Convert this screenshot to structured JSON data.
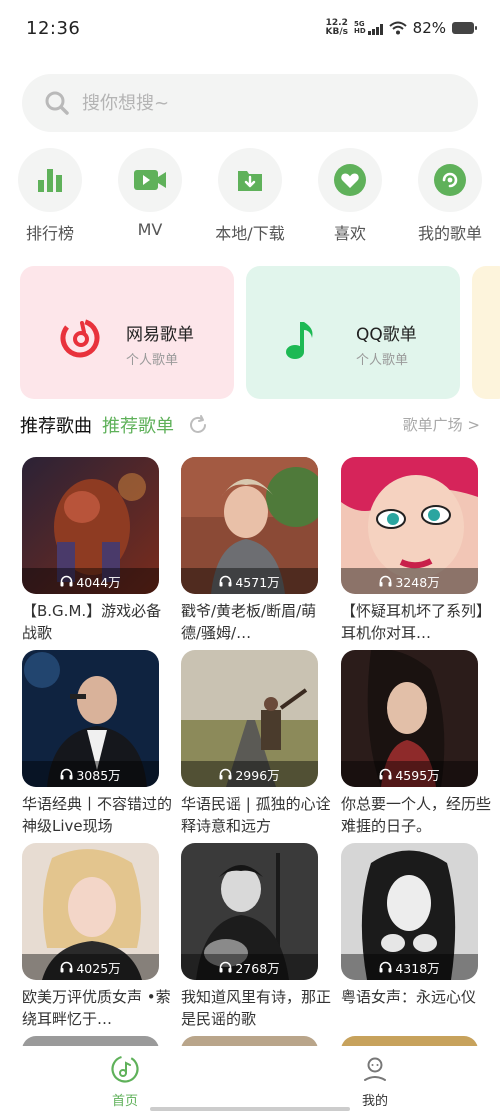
{
  "status_bar": {
    "time": "12:36",
    "net_speed_value": "12.2",
    "net_speed_unit": "KB/s",
    "signal_label_top": "5G",
    "signal_label_bottom": "HD",
    "battery": "82%"
  },
  "search": {
    "placeholder": "搜你想搜~"
  },
  "quick_nav": [
    {
      "label": "排行榜",
      "icon": "bar-chart-icon"
    },
    {
      "label": "MV",
      "icon": "video-icon"
    },
    {
      "label": "本地/下载",
      "icon": "download-folder-icon"
    },
    {
      "label": "喜欢",
      "icon": "heart-icon"
    },
    {
      "label": "我的歌单",
      "icon": "disc-icon"
    }
  ],
  "playlist_cards": [
    {
      "title": "网易歌单",
      "subtitle": "个人歌单",
      "icon": "netease-logo-icon",
      "bg": "#fde6ea"
    },
    {
      "title": "QQ歌单",
      "subtitle": "个人歌单",
      "icon": "qq-music-logo-icon",
      "bg": "#e1f5ec"
    }
  ],
  "section": {
    "tab_songs": "推荐歌曲",
    "tab_playlists": "推荐歌单",
    "more_link": "歌单广场 >"
  },
  "recommended": [
    {
      "title": "【B.G.M.】游戏必备战歌",
      "plays": "4044万"
    },
    {
      "title": "戳爷/黄老板/断眉/萌德/骚姆/…",
      "plays": "4571万"
    },
    {
      "title": "【怀疑耳机坏了系列】耳机你对耳…",
      "plays": "3248万"
    },
    {
      "title": "华语经典丨不容错过的神级Live现场",
      "plays": "3085万"
    },
    {
      "title": "华语民谣 | 孤独的心诠释诗意和远方",
      "plays": "2996万"
    },
    {
      "title": "你总要一个人，经历些难捱的日子。",
      "plays": "4595万"
    },
    {
      "title": "欧美万评优质女声 •萦绕耳畔忆于…",
      "plays": "4025万"
    },
    {
      "title": "我知道风里有诗，那正是民谣的歌",
      "plays": "2768万"
    },
    {
      "title": "粤语女声：永远心仪",
      "plays": "4318万"
    }
  ],
  "bottom_nav": [
    {
      "label": "首页",
      "icon": "home-music-icon",
      "active": true
    },
    {
      "label": "我的",
      "icon": "user-icon",
      "active": false
    }
  ],
  "colors": {
    "accent": "#5fb15a",
    "netease_red": "#e8323c",
    "qq_green": "#1db954"
  }
}
